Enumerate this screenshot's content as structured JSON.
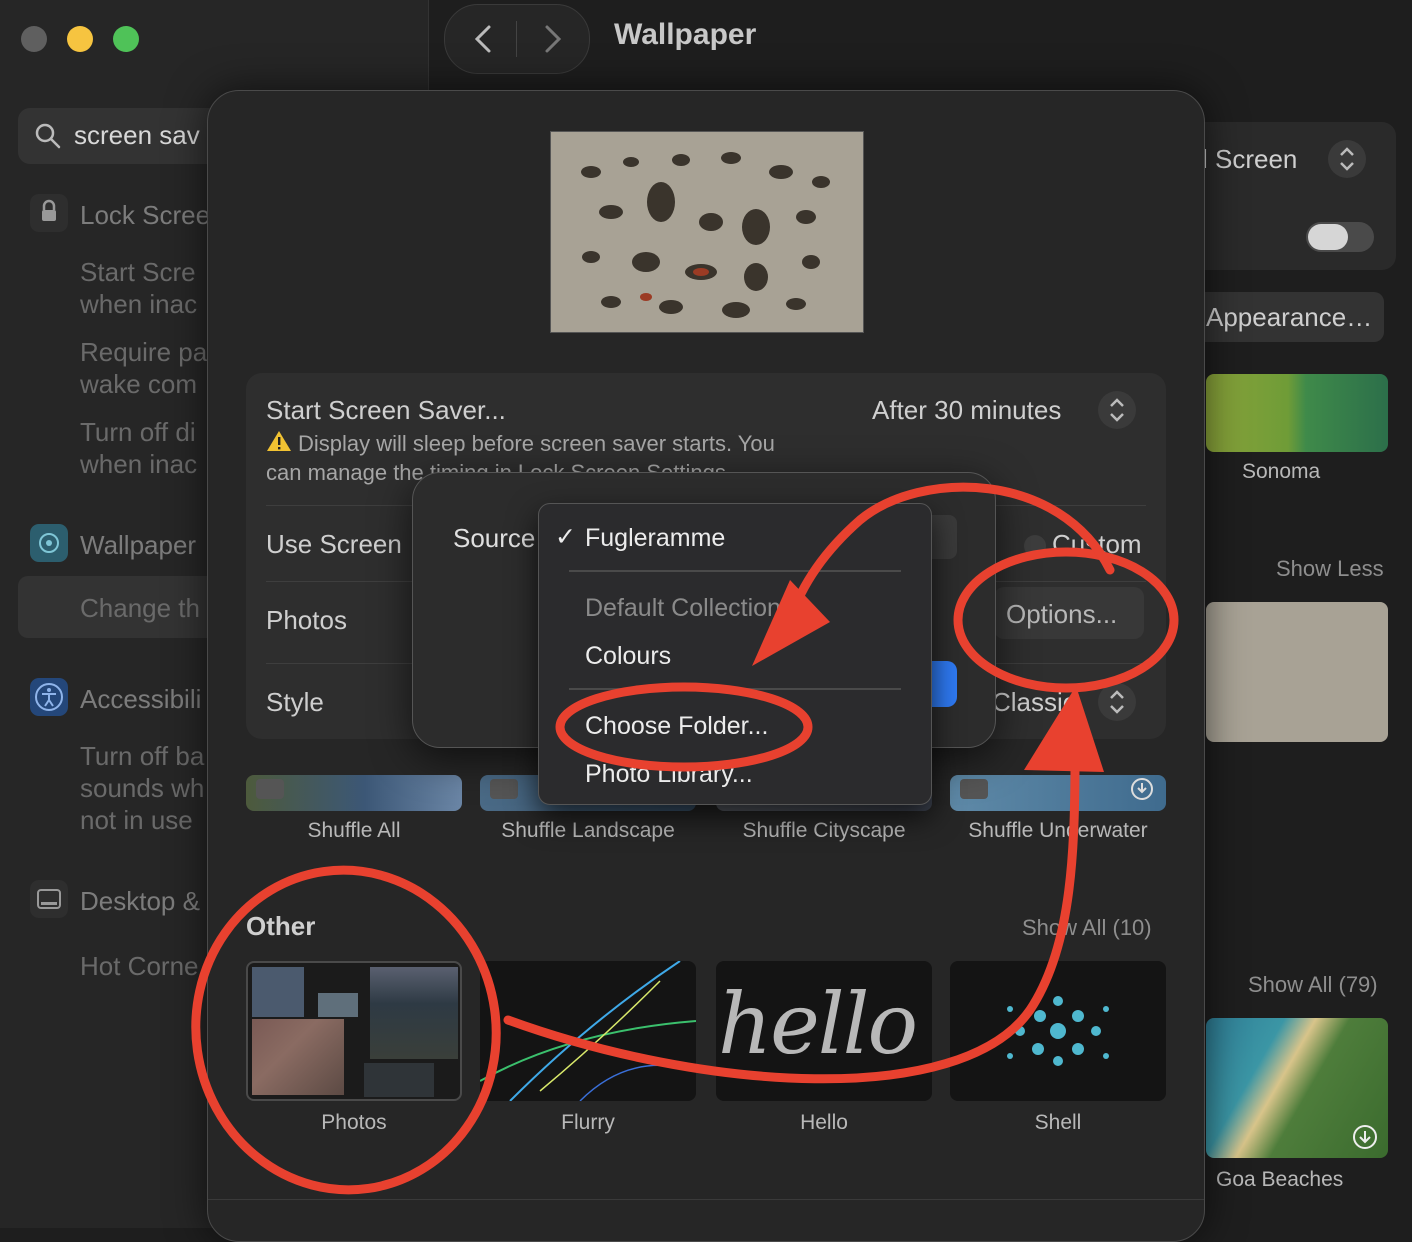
{
  "window": {
    "title": "Wallpaper",
    "colors": {
      "close": "#5f5f5f",
      "minimize": "#f6c440",
      "zoom": "#4fc258",
      "accent": "#2f7bf5",
      "annotation": "#e8412f"
    }
  },
  "sidebar": {
    "search_value": "screen sav",
    "lock_screen": {
      "title": "Lock Scree",
      "items": [
        "Start Scre\nwhen inac",
        "Require pa\nwake com",
        "Turn off di\nwhen inac"
      ]
    },
    "wallpaper": {
      "title": "Wallpaper",
      "item": "Change th"
    },
    "accessibility": {
      "title": "Accessibili",
      "item": "Turn off ba\nsounds wh\nnot in use"
    },
    "desktop": {
      "title": "Desktop &",
      "item": "Hot Corne"
    }
  },
  "right_pane": {
    "screen_select": "l Screen",
    "appearance_button": "Appearance…",
    "sonoma_label": "Sonoma",
    "show_less": "Show Less",
    "show_all_79": "Show All (79)",
    "goa_label": "Goa Beaches"
  },
  "dialog": {
    "start_screen_saver_label": "Start Screen Saver...",
    "start_screen_saver_value": "After 30 minutes",
    "warning_text": "Display will sleep before screen saver starts. You\ncan manage the timing in Lock Screen Settings.",
    "use_screen_label": "Use Screen",
    "custom_label": "Custom",
    "photos_label": "Photos",
    "options_button": "Options...",
    "style_label": "Style",
    "style_value": "Classic",
    "shuffle_captions": [
      "Shuffle All",
      "Shuffle Landscape",
      "Shuffle Cityscape",
      "Shuffle Underwater"
    ],
    "other_section_title": "Other",
    "other_show_all": "Show All (10)",
    "other_captions": [
      "Photos",
      "Flurry",
      "Hello",
      "Shell"
    ],
    "hello_text": "hello"
  },
  "source_sheet": {
    "source_label": "Source",
    "menu": {
      "selected": "Fugleramme",
      "section_header": "Default Collections:",
      "colours": "Colours",
      "choose_folder": "Choose Folder...",
      "photo_library": "Photo Library..."
    }
  }
}
